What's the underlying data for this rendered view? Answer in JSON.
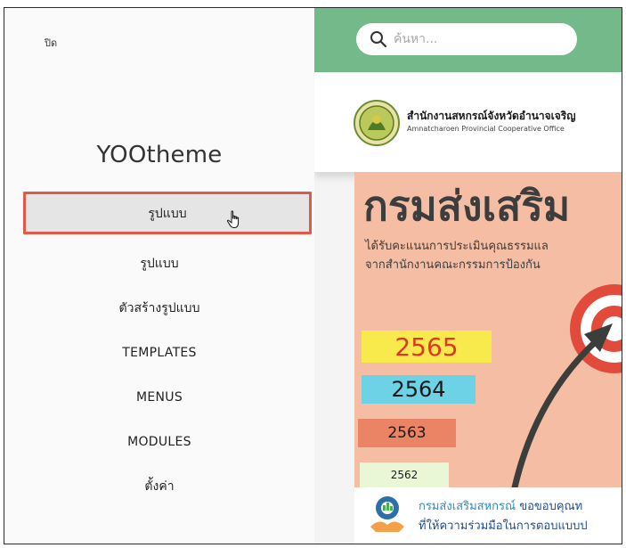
{
  "sidebar": {
    "close_label": "ปิด",
    "brand": "YOOtheme",
    "items": [
      {
        "label": "รูปแบบ",
        "active": true
      },
      {
        "label": "รูปแบบ"
      },
      {
        "label": "ตัวสร้างรูปแบบ"
      },
      {
        "label": "TEMPLATES"
      },
      {
        "label": "MENUS"
      },
      {
        "label": "MODULES"
      },
      {
        "label": "ตั้งค่า"
      }
    ]
  },
  "preview": {
    "search_placeholder": "ค้นหา...",
    "org_name_th": "สำนักงานสหกรณ์จังหวัดอำนาจเจริญ",
    "org_name_en": "Amnatcharoen Provincial Cooperative Office",
    "poster": {
      "title": "กรมส่งเสริม",
      "line1": "ได้รับคะแนนการประเมินคุณธรรมแล",
      "line2": "จากสำนักงานคณะกรรมการป้องกัน",
      "years": [
        "2565",
        "2564",
        "2563",
        "2562"
      ]
    },
    "footer": {
      "highlight": "กรมส่งเสริมสหกรณ์",
      "line1_rest": " ขอขอบคุณท",
      "line2": "ที่ให้ความร่วมมือในการตอบแบบป"
    }
  },
  "colors": {
    "topbar": "#74b98a",
    "active_border": "#e05a47",
    "poster_bg": "#f5bda3"
  }
}
